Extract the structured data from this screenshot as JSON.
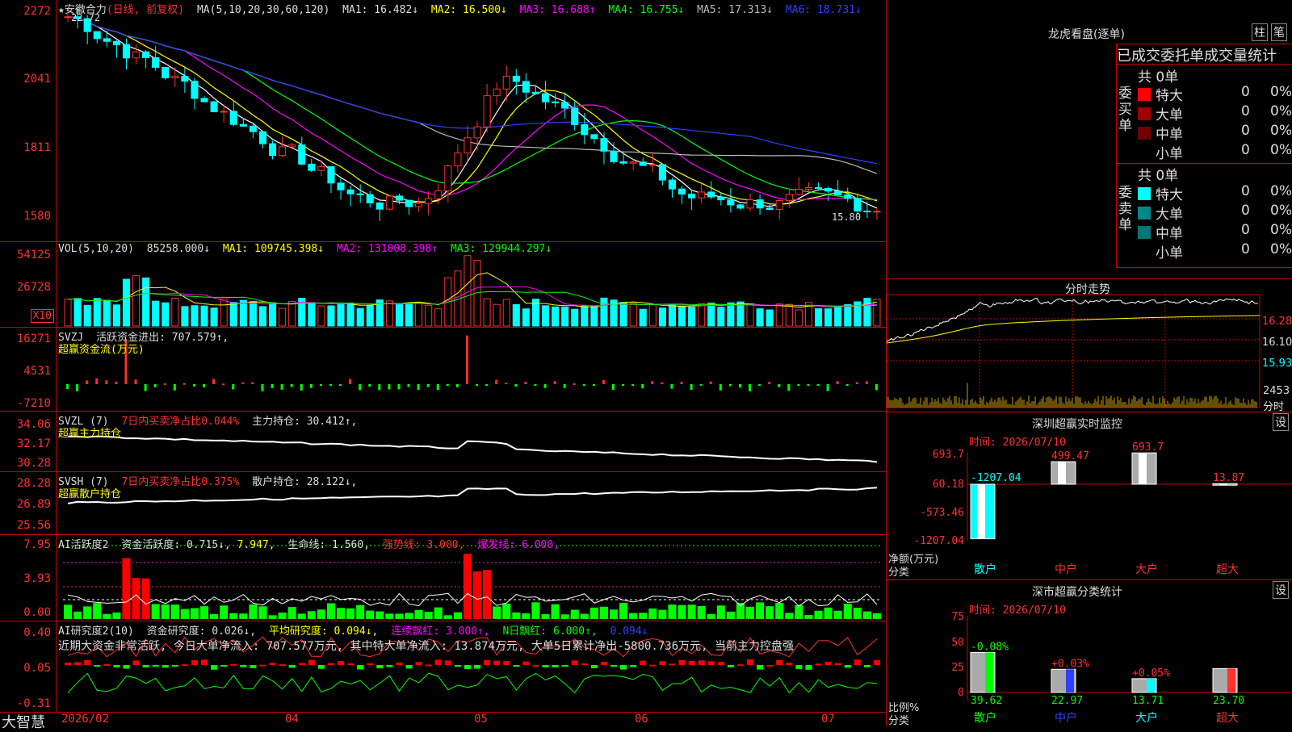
{
  "stock": {
    "name": "★安徽合力",
    "mode": "(日线, 前复权)",
    "top_mark": "22.72",
    "low_mark": "15.80"
  },
  "price_axis": [
    "2272",
    "2041",
    "1811",
    "1580"
  ],
  "ma": {
    "label": "MA(5,10,20,30,60,120)",
    "ma1": "MA1: 16.482↓",
    "ma2": "MA2: 16.500↓",
    "ma3": "MA3: 16.688↑",
    "ma4": "MA4: 16.755↓",
    "ma5": "MA5: 17.313↓",
    "ma6": "MA6: 18.731↓"
  },
  "vol": {
    "label": "VOL(5,10,20)",
    "value": "85258.000↓",
    "ma1": "MA1: 109745.398↓",
    "ma2": "MA2: 131008.398↑",
    "ma3": "MA3: 129944.297↓",
    "axis": [
      "54125",
      "26728"
    ],
    "unit": "X10"
  },
  "svzj": {
    "label": "SVZJ",
    "text1": "活跃资金进出: 707.579↑,",
    "text2": "超赢资金流(万元)",
    "axis": [
      "16271",
      "4531",
      "-7210"
    ]
  },
  "svzl": {
    "label": "SVZL (7)",
    "text1": "7日内买卖净占比0.044%",
    "text2": "主力持仓: 30.412↑,",
    "text3": "超赢主力持仓",
    "axis": [
      "34.06",
      "32.17",
      "30.28"
    ]
  },
  "svsh": {
    "label": "SVSH (7)",
    "text1": "7日内买卖净占比0.375%",
    "text2": "散户持仓: 28.122↓,",
    "text3": "超赢散户持仓",
    "axis": [
      "28.28",
      "26.89",
      "25.56"
    ]
  },
  "ai1": {
    "label": "AI活跃度2",
    "t1": "资金活跃度: 0.715↓,",
    "t2": "7.947,",
    "t3": "生命线: 1.560,",
    "t4": "强势线: 3.000,",
    "t5": "爆发线: 6.000,",
    "axis": [
      "7.95",
      "3.93",
      "0.00"
    ]
  },
  "ai2": {
    "label": "AI研究度2(10)",
    "t1": "资金研究度: 0.026↓,",
    "t2": "平均研究度: 0.094↓,",
    "t3": "连续飘红: 3.000↑,",
    "t4": "N日飘红: 6.000↑,",
    "t5": "0.094↓",
    "note": "近期大资金非常活跃, 今日大单净流入: 707.577万元, 其中特大单净流入: 13.874万元, 大单5日累计净出-5800.736万元, 当前主力控盘强",
    "axis": [
      "0.40",
      "0.05",
      "-0.31"
    ]
  },
  "dates": [
    "2026/02",
    "04",
    "05",
    "06",
    "07"
  ],
  "brand": "大智慧",
  "lhb": {
    "title": "龙虎看盘(逐单)",
    "btn1": "柱",
    "btn2": "笔",
    "subtitle": "已成交委托单成交量统计",
    "buy": {
      "side": "委买单",
      "total": "共 0单",
      "rows": [
        {
          "name": "特大",
          "n": "0",
          "p": "0%",
          "color": "#ff0000"
        },
        {
          "name": "大单",
          "n": "0",
          "p": "0%",
          "color": "#a00000"
        },
        {
          "name": "中单",
          "n": "0",
          "p": "0%",
          "color": "#700000"
        },
        {
          "name": "小单",
          "n": "0",
          "p": "0%",
          "color": ""
        }
      ]
    },
    "sell": {
      "side": "委卖单",
      "total": "共 0单",
      "rows": [
        {
          "name": "特大",
          "n": "0",
          "p": "0%",
          "color": "#00ffff"
        },
        {
          "name": "大单",
          "n": "0",
          "p": "0%",
          "color": "#008888"
        },
        {
          "name": "中单",
          "n": "0",
          "p": "0%",
          "color": "#007777"
        },
        {
          "name": "小单",
          "n": "0",
          "p": "0%",
          "color": ""
        }
      ]
    }
  },
  "intraday": {
    "title": "分时走势",
    "axis": [
      "16.28",
      "16.10",
      "15.93"
    ],
    "vol": "2453",
    "vol_unit": "分时"
  },
  "monitor": {
    "title": "深圳超赢实时监控",
    "btn": "设",
    "time": "时间: 2026/07/10",
    "axis": [
      "693.7",
      "60.18",
      "-573.46",
      "-1207.04"
    ],
    "ylabel": "净额(万元)",
    "xlabel": "分类",
    "bars": [
      {
        "cat": "散户",
        "val": "-1207.04"
      },
      {
        "cat": "中户",
        "val": "499.47"
      },
      {
        "cat": "大户",
        "val": "693.7"
      },
      {
        "cat": "超大",
        "val": "13.87"
      }
    ]
  },
  "classify": {
    "title": "深市超赢分类统计",
    "btn": "设",
    "time": "时间: 2026/07/10",
    "axis": [
      "75",
      "50",
      "25",
      "0"
    ],
    "ylabel": "比例%",
    "xlabel": "分类",
    "bars": [
      {
        "cat": "散户",
        "val": "39.62",
        "chg": "-0.08%"
      },
      {
        "cat": "中户",
        "val": "22.97",
        "chg": "+0.03%"
      },
      {
        "cat": "大户",
        "val": "13.71",
        "chg": "+0.05%"
      },
      {
        "cat": "超大",
        "val": "23.70",
        "chg": ""
      }
    ]
  }
}
